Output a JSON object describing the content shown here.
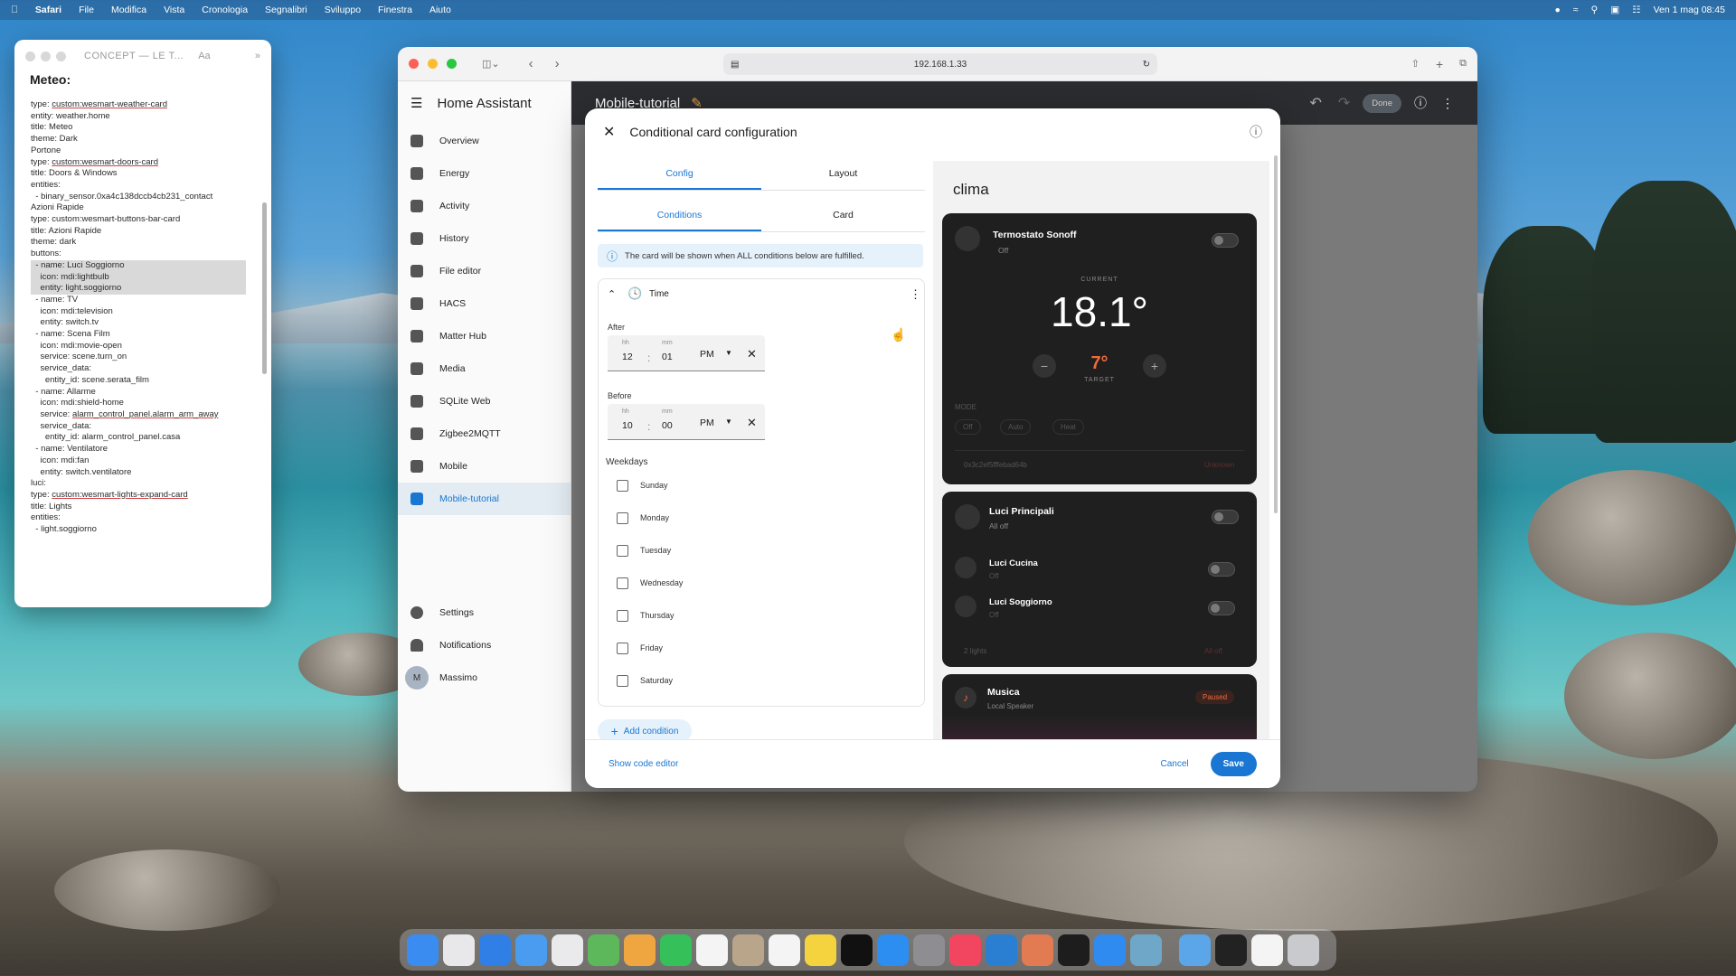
{
  "menubar": {
    "apple": "",
    "app": "Safari",
    "items": [
      "File",
      "Modifica",
      "Vista",
      "Cronologia",
      "Segnalibri",
      "Sviluppo",
      "Finestra",
      "Aiuto"
    ],
    "clock": "Ven 1 mag 08:45"
  },
  "notes": {
    "title": "CONCEPT — LE T...",
    "aa": "Aa",
    "heading": "Meteo:",
    "lines": [
      [
        "type: ",
        "custom:wesmart-weather-card",
        ""
      ],
      [
        "entity: weather.home",
        "",
        ""
      ],
      [
        "title: Meteo",
        "",
        ""
      ],
      [
        "theme: Dark",
        "",
        ""
      ],
      [
        "",
        "",
        ""
      ],
      [
        "Portone",
        "",
        ""
      ],
      [
        "",
        "",
        ""
      ],
      [
        "type: ",
        "custom:wesmart-doors-card",
        ""
      ],
      [
        "title: Doors & Windows",
        "",
        ""
      ],
      [
        "entities:",
        "",
        ""
      ],
      [
        "  - binary_sensor.0xa4c138dccb4cb231_contact",
        "",
        ""
      ],
      [
        "",
        "",
        ""
      ],
      [
        "Azioni Rapide",
        "",
        ""
      ],
      [
        "",
        "",
        ""
      ],
      [
        "type: custom:wesmart-buttons-bar-card",
        "",
        ""
      ],
      [
        "title: Azioni Rapide",
        "",
        ""
      ],
      [
        "theme: dark",
        "",
        ""
      ],
      [
        "buttons:",
        "",
        ""
      ],
      [
        "",
        "",
        "  - name: Luci Soggiorno"
      ],
      [
        "",
        "",
        "    icon: mdi:lightbulb"
      ],
      [
        "",
        "",
        "    entity: light.soggiorno"
      ],
      [
        "  - name: TV",
        "",
        ""
      ],
      [
        "    icon: mdi:television",
        "",
        ""
      ],
      [
        "    entity: switch.tv",
        "",
        ""
      ],
      [
        "  - name: Scena Film",
        "",
        ""
      ],
      [
        "    icon: mdi:movie-open",
        "",
        ""
      ],
      [
        "    service: scene.turn_on",
        "",
        ""
      ],
      [
        "    service_data:",
        "",
        ""
      ],
      [
        "      entity_id: scene.serata_film",
        "",
        ""
      ],
      [
        "  - name: Allarme",
        "",
        ""
      ],
      [
        "    icon: mdi:shield-home",
        "",
        ""
      ],
      [
        "    service: ",
        "alarm_control_panel.alarm_arm_away",
        ""
      ],
      [
        "    service_data:",
        "",
        ""
      ],
      [
        "      entity_id: alarm_control_panel.casa",
        "",
        ""
      ],
      [
        "  - name: Ventilatore",
        "",
        ""
      ],
      [
        "    icon: mdi:fan",
        "",
        ""
      ],
      [
        "    entity: switch.ventilatore",
        "",
        ""
      ],
      [
        "",
        "",
        ""
      ],
      [
        "luci:",
        "",
        ""
      ],
      [
        "",
        "",
        ""
      ],
      [
        "type: ",
        "custom:wesmart-lights-expand-card",
        ""
      ],
      [
        "title: Lights",
        "",
        ""
      ],
      [
        "entities:",
        "",
        ""
      ],
      [
        "  - light.soggiorno",
        "",
        ""
      ]
    ]
  },
  "safari": {
    "url": "192.168.1.33"
  },
  "ha": {
    "title": "Home Assistant",
    "dashboard": "Mobile-tutorial",
    "done": "Done",
    "nav": [
      {
        "label": "Overview",
        "icon": "grid-icon"
      },
      {
        "label": "Energy",
        "icon": "lightning-icon"
      },
      {
        "label": "Activity",
        "icon": "list-icon"
      },
      {
        "label": "History",
        "icon": "chart-icon"
      },
      {
        "label": "File editor",
        "icon": "wrench-icon"
      },
      {
        "label": "HACS",
        "icon": "store-icon"
      },
      {
        "label": "Matter Hub",
        "icon": "network-icon"
      },
      {
        "label": "Media",
        "icon": "media-icon"
      },
      {
        "label": "SQLite Web",
        "icon": "database-icon"
      },
      {
        "label": "Zigbee2MQTT",
        "icon": "zigbee-icon"
      },
      {
        "label": "Mobile",
        "icon": "grid-icon"
      },
      {
        "label": "Mobile-tutorial",
        "icon": "grid-icon"
      }
    ],
    "bottom": [
      {
        "label": "Settings",
        "icon": "gear-icon"
      },
      {
        "label": "Notifications",
        "icon": "bell-icon"
      }
    ],
    "user": {
      "initial": "M",
      "name": "Massimo"
    }
  },
  "dialog": {
    "title": "Conditional card configuration",
    "tabs": [
      "Config",
      "Layout"
    ],
    "subtabs": [
      "Conditions",
      "Card"
    ],
    "info": "The card will be shown when ALL conditions below are fulfilled.",
    "condition": "Time",
    "after_label": "After",
    "before_label": "Before",
    "after": {
      "hh": "12",
      "mm": "01",
      "ampm": "PM"
    },
    "before": {
      "hh": "10",
      "mm": "00",
      "ampm": "PM"
    },
    "hh_label": "hh",
    "mm_label": "mm",
    "weekdays_label": "Weekdays",
    "weekdays": [
      "Sunday",
      "Monday",
      "Tuesday",
      "Wednesday",
      "Thursday",
      "Friday",
      "Saturday"
    ],
    "add": "Add condition",
    "code": "Show code editor",
    "cancel": "Cancel",
    "save": "Save"
  },
  "preview": {
    "title": "clima",
    "thermo": {
      "name": "Termostato Sonoff",
      "state": "Off",
      "current_label": "CURRENT",
      "current": "18.1°",
      "target": "7°",
      "target_label": "TARGET",
      "mode_label": "MODE",
      "modes": [
        "Off",
        "Auto",
        "Heat"
      ],
      "footer": "0x3c2ef5fffebad64b",
      "footer_right": "Unknown"
    },
    "lights": {
      "name": "Luci Principali",
      "state": "All off",
      "items": [
        {
          "name": "Luci Cucina",
          "state": "Off"
        },
        {
          "name": "Luci Soggiorno",
          "state": "Off"
        }
      ],
      "footer": "2 lights",
      "footer_right": "All off"
    },
    "music": {
      "name": "Musica",
      "sub": "Local Speaker",
      "badge": "Paused"
    }
  },
  "dock": {
    "apps": [
      {
        "icon": "finder-icon",
        "color": "#3b8cf0"
      },
      {
        "icon": "launchpad-icon",
        "color": "#e8e8ea"
      },
      {
        "icon": "safari-icon",
        "color": "#2f7fe6"
      },
      {
        "icon": "mail-icon",
        "color": "#4a9cf0"
      },
      {
        "icon": "mail-alt-icon",
        "color": "#eaeaec"
      },
      {
        "icon": "maps-icon",
        "color": "#5db85c"
      },
      {
        "icon": "photos-icon",
        "color": "#f0a640"
      },
      {
        "icon": "facetime-icon",
        "color": "#36c05a"
      },
      {
        "icon": "calendar-icon",
        "color": "#f4f4f4"
      },
      {
        "icon": "contacts-icon",
        "color": "#b8a58a"
      },
      {
        "icon": "reminders-icon",
        "color": "#f4f4f4"
      },
      {
        "icon": "notes-icon",
        "color": "#f5d33f"
      },
      {
        "icon": "tv-icon",
        "color": "#111"
      },
      {
        "icon": "appstore-icon",
        "color": "#2c8ef0"
      },
      {
        "icon": "settings-icon",
        "color": "#8d8d92"
      },
      {
        "icon": "music-icon",
        "color": "#f24660"
      },
      {
        "icon": "vscode-icon",
        "color": "#2a7fd2"
      },
      {
        "icon": "claude-icon",
        "color": "#e27b52"
      },
      {
        "icon": "terminal-icon",
        "color": "#1d1d1d"
      },
      {
        "icon": "xcode-icon",
        "color": "#2f8bf0"
      },
      {
        "icon": "preview-icon",
        "color": "#6fa7c9"
      },
      {
        "icon": "folder-icon",
        "color": "#5aa6e8"
      },
      {
        "icon": "window-icon",
        "color": "#222"
      },
      {
        "icon": "document-icon",
        "color": "#f4f4f4"
      },
      {
        "icon": "trash-icon",
        "color": "#c9cacd"
      }
    ]
  }
}
